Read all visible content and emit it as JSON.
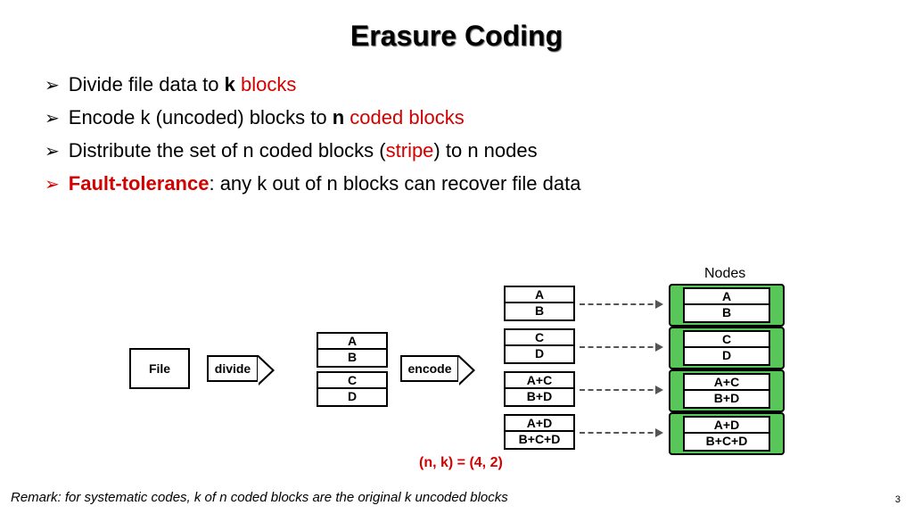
{
  "title": "Erasure Coding",
  "bullets": {
    "b1": {
      "pre": "Divide file data to ",
      "k": "k",
      "post": " blocks"
    },
    "b2": {
      "pre": "Encode k (uncoded) blocks to ",
      "n": "n",
      "post": " coded blocks"
    },
    "b3": {
      "pre": "Distribute the set of n coded blocks (",
      "stripe": "stripe",
      "post": ") to n nodes"
    },
    "b4": {
      "ft": "Fault-tolerance",
      "rest": ": any k out of n blocks can recover file data"
    }
  },
  "labels": {
    "file": "File",
    "divide": "divide",
    "encode": "encode",
    "nodes": "Nodes",
    "nk": "(n, k) = (4, 2)"
  },
  "blocks": {
    "ab": {
      "r1": "A",
      "r2": "B"
    },
    "cd": {
      "r1": "C",
      "r2": "D"
    },
    "ac_bd": {
      "r1": "A+C",
      "r2": "B+D"
    },
    "ad_bcd": {
      "r1": "A+D",
      "r2": "B+C+D"
    }
  },
  "remark": "Remark: for systematic codes, k of n coded blocks are the original k uncoded blocks",
  "page": "3"
}
